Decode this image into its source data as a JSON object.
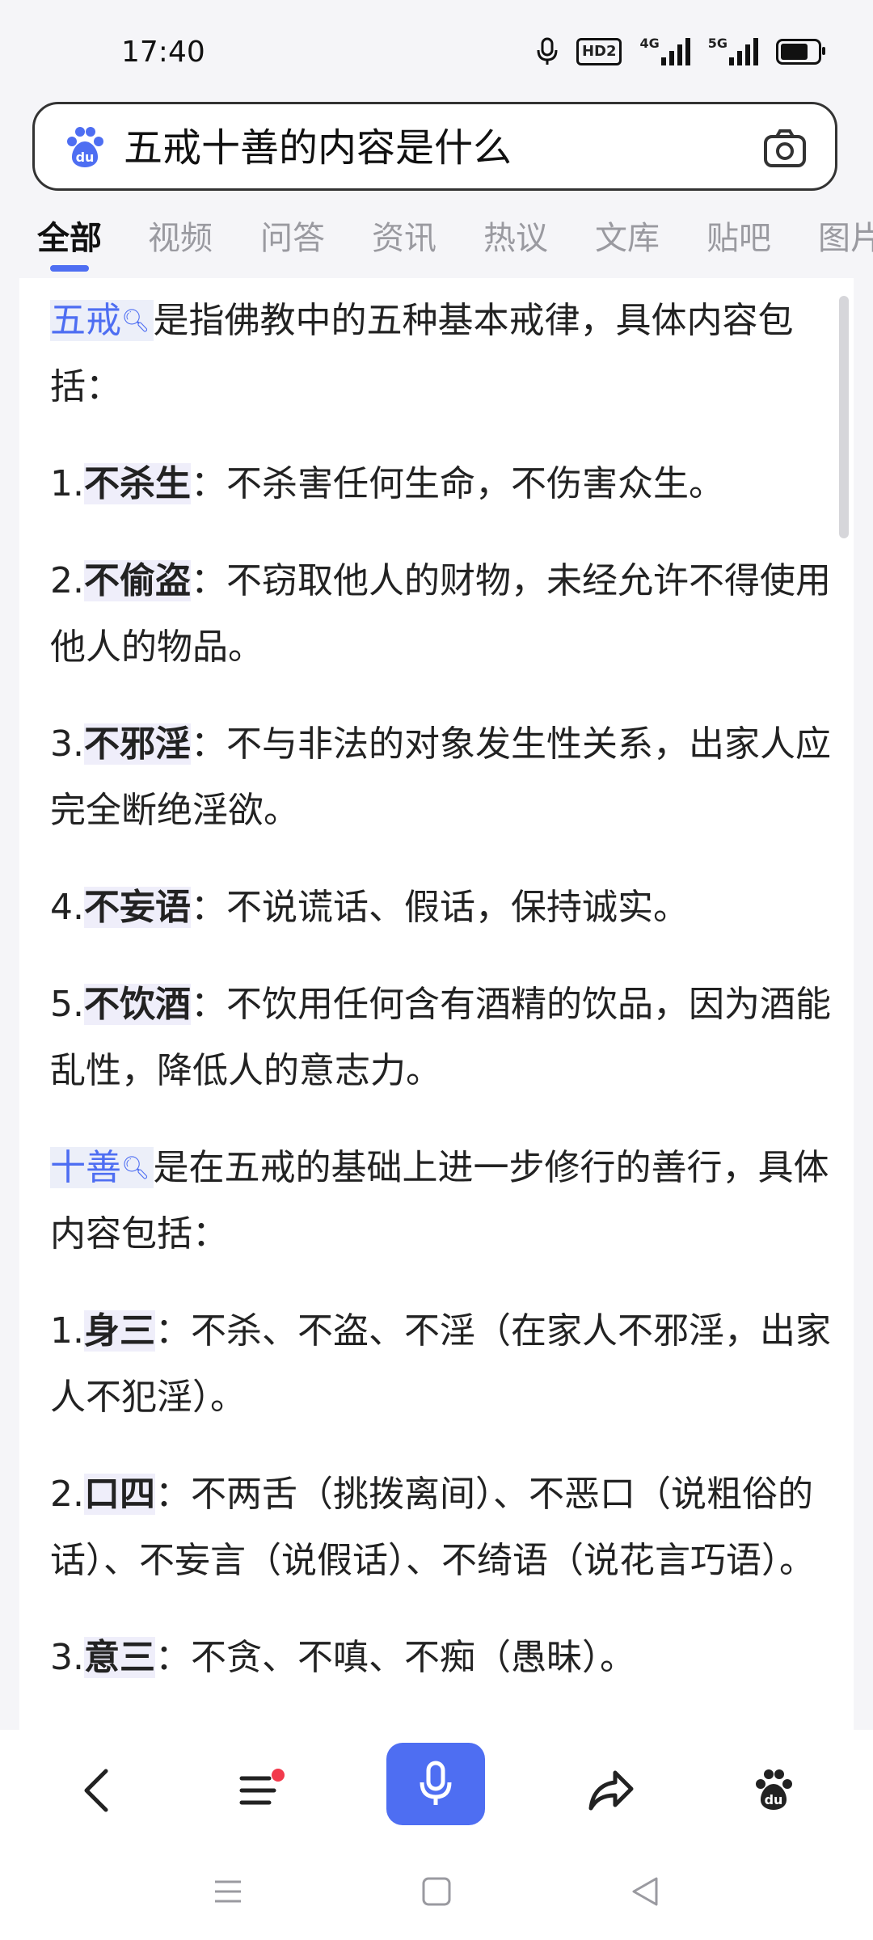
{
  "status_bar": {
    "time": "17:40",
    "icons": [
      "mic-icon",
      "hd-icon",
      "signal-4g-icon",
      "signal-5g-icon",
      "battery-icon"
    ],
    "hd_label": "HD2",
    "sig1_label": "4G",
    "sig2_label": "5G",
    "battery_level": 0.75
  },
  "search": {
    "query": "五戒十善的内容是什么",
    "logo": "baidu-paw-icon",
    "camera": "camera-icon"
  },
  "tabs": [
    {
      "label": "全部",
      "active": true
    },
    {
      "label": "视频"
    },
    {
      "label": "问答"
    },
    {
      "label": "资讯"
    },
    {
      "label": "热议"
    },
    {
      "label": "文库"
    },
    {
      "label": "贴吧"
    },
    {
      "label": "图片"
    }
  ],
  "article": {
    "p1_term": "五戒",
    "p1_rest": "是指佛教中的五种基本戒律，具体内容包括：",
    "wujie": [
      {
        "num": "1.",
        "term": "不杀生",
        "text": "：不杀害任何生命，不伤害众生。"
      },
      {
        "num": "2.",
        "term": "不偷盗",
        "text": "：不窃取他人的财物，未经允许不得使用他人的物品。"
      },
      {
        "num": "3.",
        "term": "不邪淫",
        "text": "：不与非法的对象发生性关系，出家人应完全断绝淫欲。"
      },
      {
        "num": "4.",
        "term": "不妄语",
        "text": "：不说谎话、假话，保持诚实。"
      },
      {
        "num": "5.",
        "term": "不饮酒",
        "text": "：不饮用任何含有酒精的饮品，因为酒能乱性，降低人的意志力。"
      }
    ],
    "p2_term": "十善",
    "p2_rest": "是在五戒的基础上进一步修行的善行，具体内容包括：",
    "shishan": [
      {
        "num": "1.",
        "term": "身三",
        "text": "：不杀、不盗、不淫（在家人不邪淫，出家人不犯淫）。"
      },
      {
        "num": "2.",
        "term": "口四",
        "text": "：不两舌（挑拨离间）、不恶口（说粗俗的话）、不妄言（说假话）、不绮语（说花言巧语）。"
      },
      {
        "num": "3.",
        "term": "意三",
        "text": "：不贪、不嗔、不痴（愚昧）。"
      }
    ]
  },
  "toolbar": {
    "items": [
      "back-icon",
      "menu-icon",
      "voice-mic-icon",
      "share-icon",
      "baidu-paw-icon"
    ],
    "accent": "#4e6ef2",
    "notification_color": "#f23a4c"
  },
  "navbar": {
    "items": [
      "recent-apps-icon",
      "home-icon",
      "back-triangle-icon"
    ]
  }
}
